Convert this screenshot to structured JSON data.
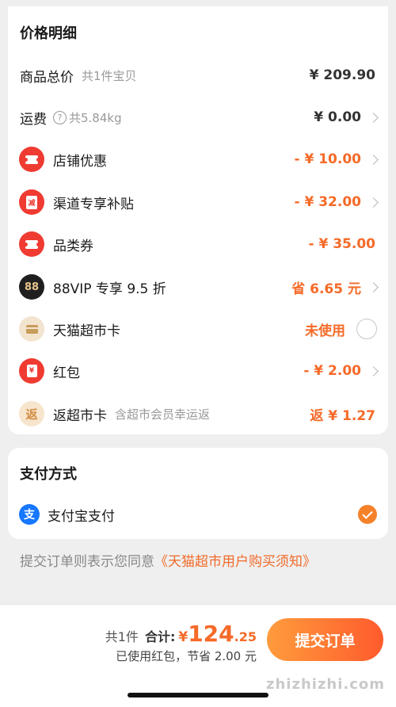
{
  "price_section": {
    "title": "价格明细",
    "rows": [
      {
        "label": "商品总价",
        "sub": "共1件宝贝",
        "value": "¥ 209.90"
      },
      {
        "label": "运费",
        "sub": "共5.84kg",
        "value": "¥ 0.00"
      },
      {
        "label": "店铺优惠",
        "value": "- ¥ 10.00",
        "icon": "shop-coupon-icon"
      },
      {
        "label": "渠道专享补贴",
        "value": "- ¥ 32.00",
        "icon": "subsidy-icon",
        "icon_text": "减"
      },
      {
        "label": "品类券",
        "value": "- ¥ 35.00",
        "icon": "category-coupon-icon"
      },
      {
        "label": "88VIP 专享 9.5 折",
        "value": "省 6.65 元",
        "icon": "vip-88-icon",
        "icon_text": "88"
      },
      {
        "label": "天猫超市卡",
        "value": "未使用",
        "icon": "market-card-icon"
      },
      {
        "label": "红包",
        "value": "- ¥ 2.00",
        "icon": "red-packet-icon",
        "icon_text": "¥"
      },
      {
        "label": "返超市卡",
        "sub": "含超市会员幸运返",
        "value": "返 ¥ 1.27",
        "icon": "cashback-icon",
        "icon_text": "返"
      }
    ]
  },
  "payment_section": {
    "title": "支付方式",
    "method": "支付宝支付",
    "method_icon_text": "支"
  },
  "agreement": {
    "text": "提交订单则表示您同意",
    "link": "《天猫超市用户购买须知》"
  },
  "footer": {
    "count": "共1件",
    "total_label": "合计:",
    "currency": "¥",
    "total_int": "124",
    "total_dec": ".25",
    "saving": "已使用红包，节省 2.00 元",
    "submit": "提交订单",
    "watermark": "zhizhizhi.com"
  },
  "colors": {
    "accent": "#f56a28",
    "danger": "#ef3b32",
    "alipay": "#1677ff"
  }
}
